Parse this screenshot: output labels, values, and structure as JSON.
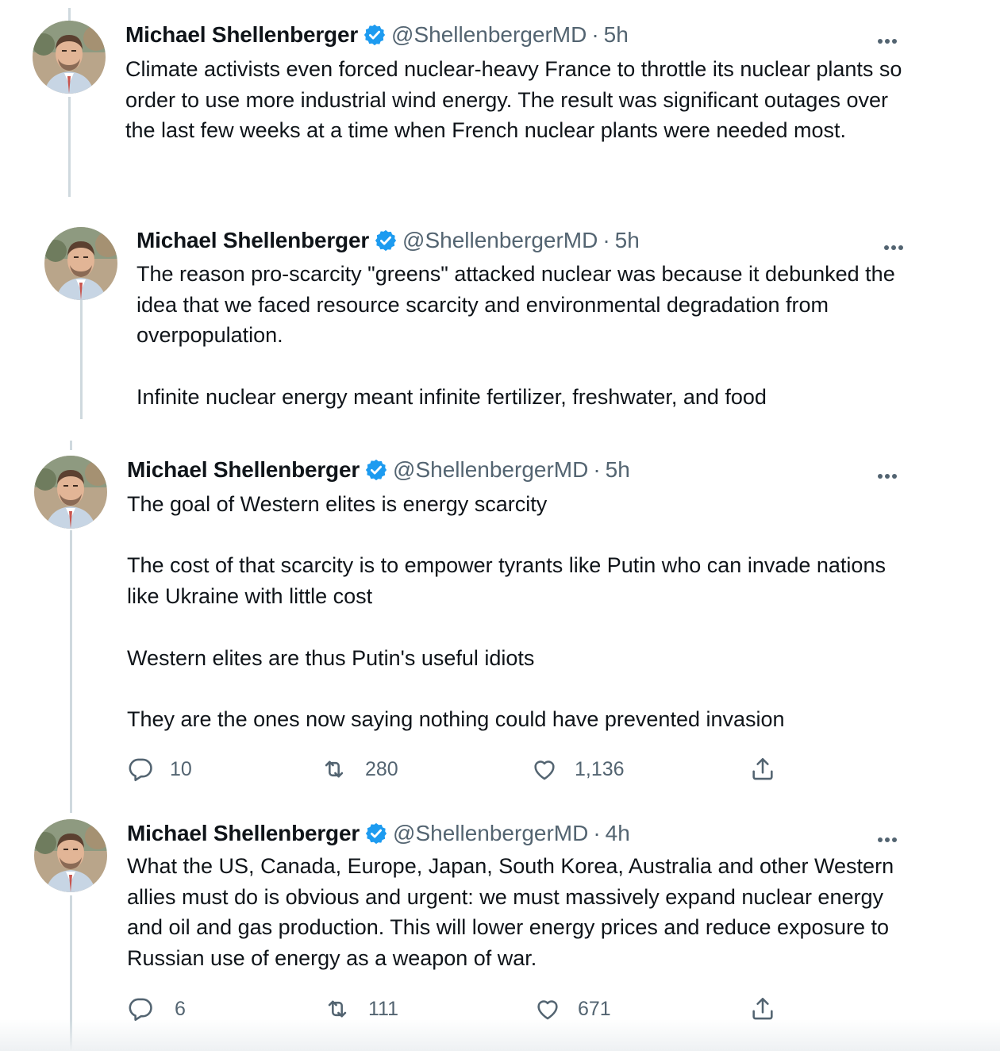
{
  "colors": {
    "verified": "#1d9bf0",
    "text": "#0f1419",
    "muted": "#536471",
    "thread_line": "#cfd9de"
  },
  "tweets": [
    {
      "name": "Michael Shellenberger",
      "handle": "@ShellenbergerMD",
      "separator": "·",
      "time": "5h",
      "text": "Climate activists even forced nuclear-heavy France to throttle its nuclear plants so order to use more industrial wind energy. The result was significant outages over the last few weeks at a time when French nuclear plants were needed most."
    },
    {
      "name": "Michael Shellenberger",
      "handle": "@ShellenbergerMD",
      "separator": "·",
      "time": "5h",
      "text": "The reason pro-scarcity \"greens\" attacked nuclear was because it debunked the idea that we faced resource scarcity and environmental degradation from overpopulation.\n\nInfinite nuclear energy meant infinite fertilizer, freshwater, and food"
    },
    {
      "name": "Michael Shellenberger",
      "handle": "@ShellenbergerMD",
      "separator": "·",
      "time": "5h",
      "text": "The goal of Western elites is energy scarcity\n\nThe cost of that scarcity is to empower tyrants like Putin who can invade nations like Ukraine with little cost\n\nWestern elites are thus Putin's useful idiots\n\nThey are the ones now saying nothing could have prevented invasion",
      "replies": "10",
      "retweets": "280",
      "likes": "1,136"
    },
    {
      "name": "Michael Shellenberger",
      "handle": "@ShellenbergerMD",
      "separator": "·",
      "time": "4h",
      "text": "What the US, Canada, Europe, Japan, South Korea, Australia and other Western allies must do is obvious and urgent: we must massively expand nuclear energy and oil and gas production. This will lower energy prices and reduce exposure to Russian use of energy as a weapon of war.",
      "replies": "6",
      "retweets": "111",
      "likes": "671"
    }
  ]
}
